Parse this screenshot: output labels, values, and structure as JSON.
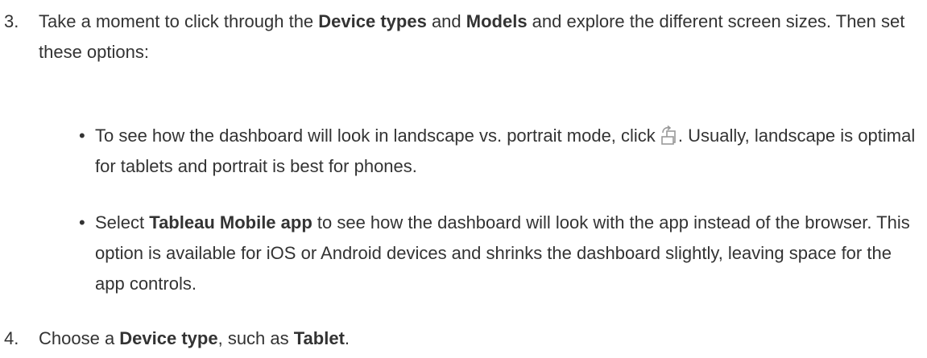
{
  "step3": {
    "number": "3.",
    "text_before_1": "Take a moment to click through the ",
    "bold_1": "Device types",
    "text_mid_1": " and ",
    "bold_2": "Models",
    "text_after_1": " and explore the different screen sizes. Then set these options:"
  },
  "bullets": [
    {
      "marker": "•",
      "text_before": "To see how the dashboard will look in landscape vs. portrait mode, click ",
      "icon": "rotate-screen-icon",
      "text_after": ". Usually, landscape is optimal for tablets and portrait is best for phones."
    },
    {
      "marker": "•",
      "text_before": "Select ",
      "bold": "Tableau Mobile app",
      "text_after": " to see how the dashboard will look with the app instead of the browser. This option is available for iOS or Android devices and shrinks the dashboard slightly, leaving space for the app controls."
    }
  ],
  "step4": {
    "number": "4.",
    "text_before": "Choose a ",
    "bold_1": "Device type",
    "text_mid": ", such as ",
    "bold_2": "Tablet",
    "text_after": "."
  },
  "colors": {
    "text": "#333333",
    "icon": "#999999"
  }
}
